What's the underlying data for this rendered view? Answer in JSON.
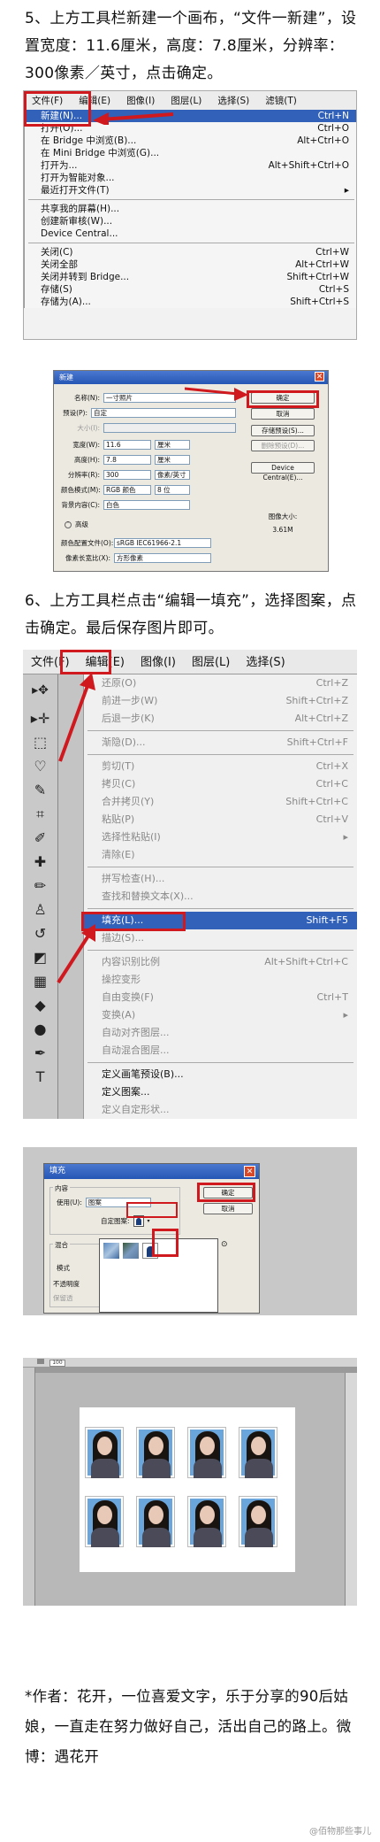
{
  "step5": "5、上方工具栏新建一个画布，“文件一新建”，设置宽度：11.6厘米，高度：7.8厘米，分辨率：300像素／英寸，点击确定。",
  "menu1": {
    "bar": [
      "文件(F)",
      "编辑(E)",
      "图像(I)",
      "图层(L)",
      "选择(S)",
      "滤镜(T)"
    ],
    "items": [
      {
        "label": "新建(N)...",
        "shortcut": "Ctrl+N"
      },
      {
        "label": "打开(O)...",
        "shortcut": "Ctrl+O"
      },
      {
        "label": "在 Bridge 中浏览(B)...",
        "shortcut": "Alt+Ctrl+O"
      },
      {
        "label": "在 Mini Bridge 中浏览(G)...",
        "shortcut": ""
      },
      {
        "label": "打开为...",
        "shortcut": "Alt+Shift+Ctrl+O"
      },
      {
        "label": "打开为智能对象...",
        "shortcut": ""
      },
      {
        "label": "最近打开文件(T)",
        "shortcut": "▸"
      },
      {
        "label": "共享我的屏幕(H)...",
        "shortcut": ""
      },
      {
        "label": "创建新审核(W)...",
        "shortcut": ""
      },
      {
        "label": "Device Central...",
        "shortcut": ""
      },
      {
        "label": "关闭(C)",
        "shortcut": "Ctrl+W"
      },
      {
        "label": "关闭全部",
        "shortcut": "Alt+Ctrl+W"
      },
      {
        "label": "关闭并转到 Bridge...",
        "shortcut": "Shift+Ctrl+W"
      },
      {
        "label": "存储(S)",
        "shortcut": "Ctrl+S"
      },
      {
        "label": "存储为(A)...",
        "shortcut": "Shift+Ctrl+S"
      }
    ]
  },
  "newdlg": {
    "title": "新建",
    "name_label": "名称(N):",
    "name_value": "一寸照片",
    "preset_label": "预设(P):",
    "preset_value": "自定",
    "size_label": "大小(I):",
    "width_label": "宽度(W):",
    "width_value": "11.6",
    "width_unit": "厘米",
    "height_label": "高度(H):",
    "height_value": "7.8",
    "height_unit": "厘米",
    "res_label": "分辨率(R):",
    "res_value": "300",
    "res_unit": "像素/英寸",
    "mode_label": "颜色模式(M):",
    "mode_value": "RGB 颜色",
    "bits_value": "8 位",
    "bg_label": "背景内容(C):",
    "bg_value": "白色",
    "adv_label": "高级",
    "profile_label": "颜色配置文件(O):",
    "profile_value": "sRGB IEC61966-2.1",
    "aspect_label": "像素长宽比(X):",
    "aspect_value": "方形像素",
    "ok": "确定",
    "cancel": "取消",
    "save_preset": "存储预设(S)...",
    "delete_preset": "删除预设(D)...",
    "device_central": "Device Central(E)...",
    "img_size_label": "图像大小:",
    "img_size_value": "3.61M"
  },
  "step6": "6、上方工具栏点击“编辑一填充”，选择图案，点击确定。最后保存图片即可。",
  "menu2": {
    "bar": [
      "文件(F)",
      "编辑(E)",
      "图像(I)",
      "图层(L)",
      "选择(S)"
    ],
    "items": [
      {
        "label": "还原(O)",
        "shortcut": "Ctrl+Z",
        "dis": true
      },
      {
        "label": "前进一步(W)",
        "shortcut": "Shift+Ctrl+Z",
        "dis": true
      },
      {
        "label": "后退一步(K)",
        "shortcut": "Alt+Ctrl+Z",
        "dis": true
      },
      {
        "label": "渐隐(D)...",
        "shortcut": "Shift+Ctrl+F",
        "dis": true
      },
      {
        "label": "剪切(T)",
        "shortcut": "Ctrl+X",
        "dis": true
      },
      {
        "label": "拷贝(C)",
        "shortcut": "Ctrl+C",
        "dis": true
      },
      {
        "label": "合并拷贝(Y)",
        "shortcut": "Shift+Ctrl+C",
        "dis": true
      },
      {
        "label": "粘贴(P)",
        "shortcut": "Ctrl+V",
        "dis": true
      },
      {
        "label": "选择性粘贴(I)",
        "shortcut": "▸",
        "dis": true
      },
      {
        "label": "清除(E)",
        "shortcut": "",
        "dis": true
      },
      {
        "label": "拼写检查(H)...",
        "shortcut": "",
        "dis": true
      },
      {
        "label": "查找和替换文本(X)...",
        "shortcut": "",
        "dis": true
      },
      {
        "label": "填充(L)...",
        "shortcut": "Shift+F5",
        "sel": true
      },
      {
        "label": "描边(S)...",
        "shortcut": "",
        "dis": true
      },
      {
        "label": "内容识别比例",
        "shortcut": "Alt+Shift+Ctrl+C",
        "dis": true
      },
      {
        "label": "操控变形",
        "shortcut": "",
        "dis": true
      },
      {
        "label": "自由变换(F)",
        "shortcut": "Ctrl+T",
        "dis": true
      },
      {
        "label": "变换(A)",
        "shortcut": "▸",
        "dis": true
      },
      {
        "label": "自动对齐图层...",
        "shortcut": "",
        "dis": true
      },
      {
        "label": "自动混合图层...",
        "shortcut": "",
        "dis": true
      },
      {
        "label": "定义画笔预设(B)...",
        "shortcut": ""
      },
      {
        "label": "定义图案...",
        "shortcut": ""
      },
      {
        "label": "定义自定形状...",
        "shortcut": "",
        "dis": true
      }
    ]
  },
  "filldlg": {
    "title": "填充",
    "content_label": "内容",
    "use_label": "使用(U):",
    "use_value": "图案",
    "pattern_label": "自定图案:",
    "blend_label": "混合",
    "mode_label": "模式",
    "opacity_label": "不透明度",
    "preserve_label": "保留透",
    "ok": "确定",
    "cancel": "取消"
  },
  "psbar": {
    "zoom": "100"
  },
  "author": "*作者：花开，一位喜爱文字，乐于分享的90后姑娘，一直走在努力做好自己，活出自己的路上。微博：遇花开",
  "watermark": "@佰物那些事儿"
}
